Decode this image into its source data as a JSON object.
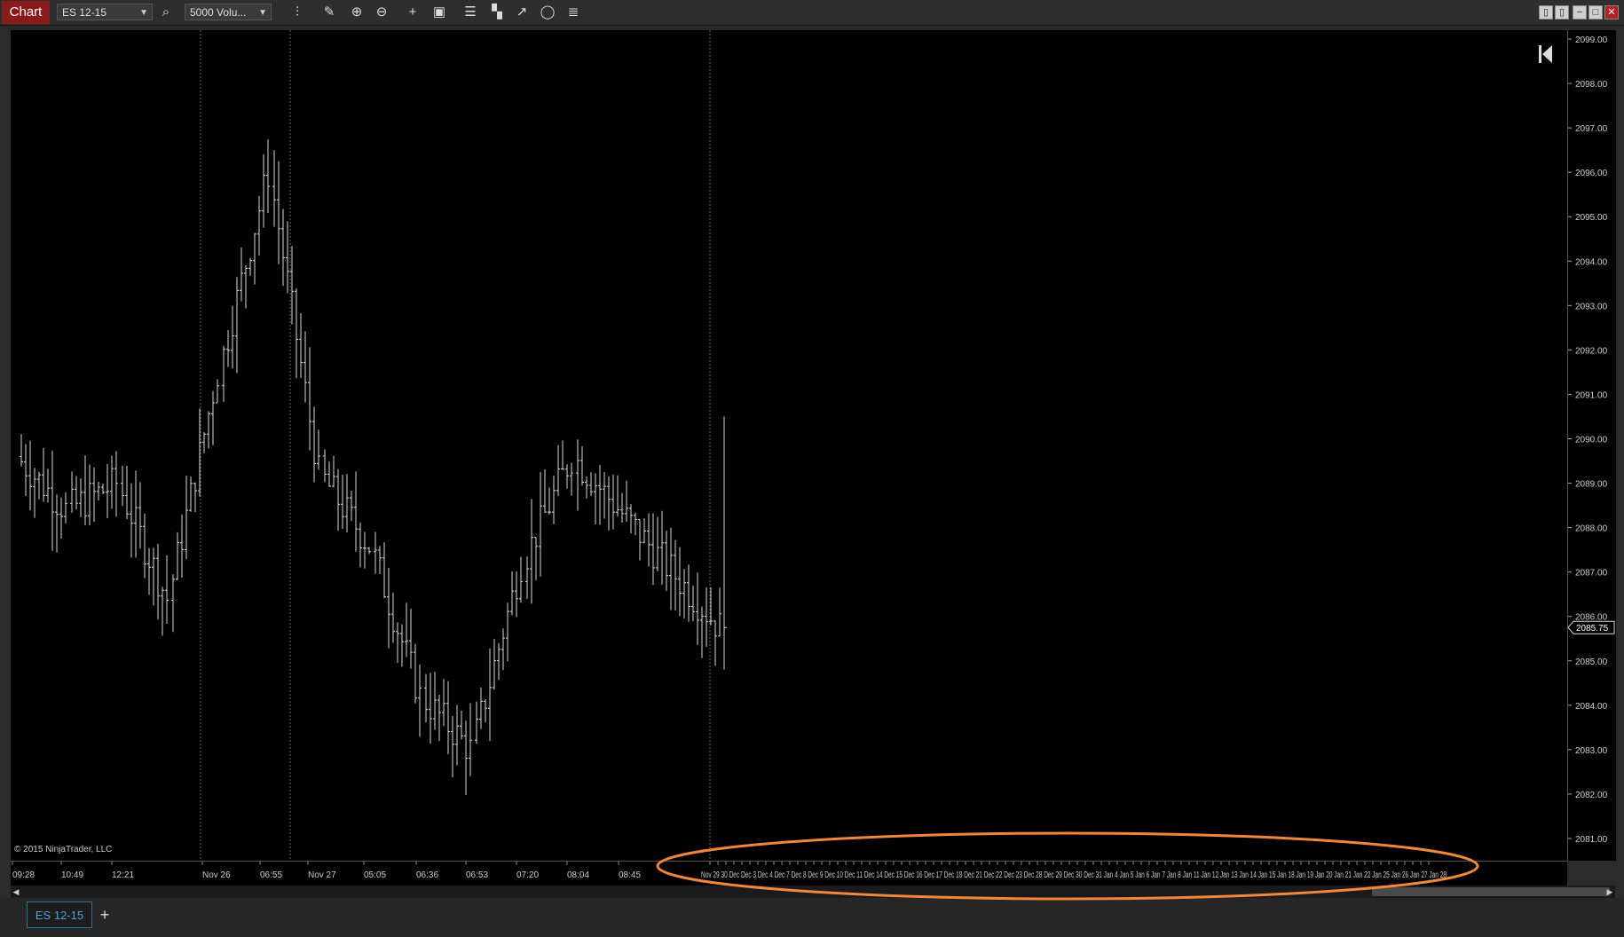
{
  "toolbar": {
    "chart_tab": "Chart",
    "instrument": "ES 12-15",
    "bar_type": "5000 Volu...",
    "icons": [
      "search-icon",
      "bars-icon",
      "pencil-icon",
      "zoom-in-icon",
      "zoom-out-icon",
      "crosshair-icon",
      "data-box-icon",
      "properties-icon",
      "drawing-tools-icon",
      "strategies-icon",
      "indicators-icon",
      "list-icon"
    ]
  },
  "chart": {
    "copyright": "© 2015 NinjaTrader, LLC",
    "current_price": "2085.75",
    "price_labels": [
      "2099.00",
      "2098.00",
      "2097.00",
      "2096.00",
      "2095.00",
      "2094.00",
      "2093.00",
      "2092.00",
      "2091.00",
      "2090.00",
      "2089.00",
      "2088.00",
      "2087.00",
      "2086.00",
      "2085.00",
      "2084.00",
      "2083.00",
      "2082.00",
      "2081.00"
    ],
    "time_labels": [
      "09:28",
      "10:49",
      "12:21",
      "Nov 26",
      "06:55",
      "Nov 27",
      "05:05",
      "06:36",
      "06:53",
      "07:20",
      "08:04",
      "08:45"
    ],
    "future_labels": "Nov 29 30 Dec Dec 3 Dec 4 Dec 7 Dec 8 Dec 9 Dec 10 Dec 11 Dec 14 Dec 15 Dec 16 Dec 17 Dec 18 Dec 21 Dec 22 Dec 23 Dec 28 Dec 29 Dec 30 Dec 31 Jan 4 Jan 5 Jan 6 Jan 7 Jan 8 Jan 11 Jan 12 Jan 13 Jan 14 Jan 15 Jan 18 Jan 19 Jan 20 Jan 21 Jan 22 Jan 25 Jan 26 Jan 27 Jan 28",
    "highlight_color": "#f0883c",
    "bar_color": "#ffffff"
  },
  "chart_data": {
    "type": "ohlc",
    "title": "",
    "ylim": [
      2080.5,
      2099.2
    ],
    "x": [
      "09:28",
      "10:49",
      "12:21",
      "Nov 26",
      "06:55",
      "Nov 27",
      "05:05",
      "06:36",
      "06:53",
      "07:20",
      "08:04",
      "08:45",
      "Nov 30"
    ],
    "close": [
      2089.6,
      2088.4,
      2089.0,
      2086.4,
      2091.5,
      2096.0,
      2089.2,
      2087.6,
      2084.2,
      2083.0,
      2087.2,
      2089.6,
      2085.75
    ],
    "high": [
      2090.5,
      2089.8,
      2090.0,
      2087.8,
      2092.5,
      2098.2,
      2091.7,
      2088.8,
      2085.4,
      2084.4,
      2088.6,
      2091.2,
      2090.5
    ],
    "low": [
      2088.8,
      2087.5,
      2088.2,
      2085.8,
      2088.5,
      2093.2,
      2083.3,
      2085.2,
      2081.6,
      2082.2,
      2085.8,
      2087.6,
      2084.8
    ]
  },
  "bottom_tabs": {
    "active": "ES 12-15",
    "add": "+"
  },
  "window_buttons": [
    "□",
    "□",
    "−",
    "□",
    "✕"
  ]
}
